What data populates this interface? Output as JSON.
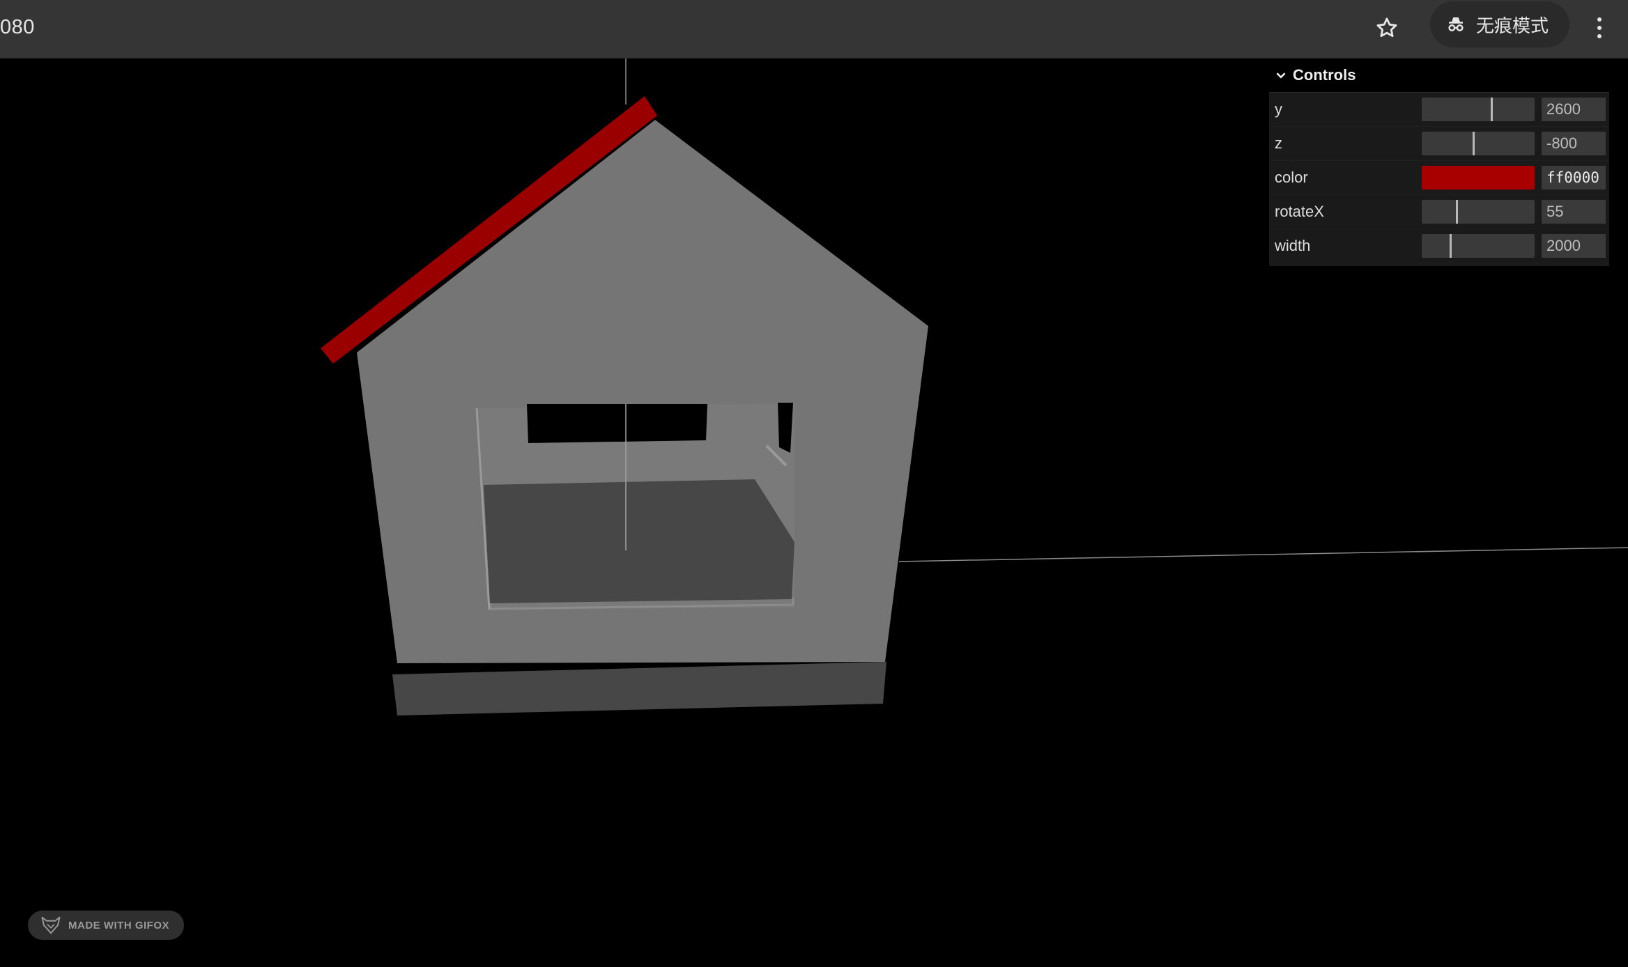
{
  "browser": {
    "url_fragment": "080",
    "incognito_label": "无痕模式",
    "icons": [
      "star-icon",
      "incognito-icon",
      "more-vert-icon"
    ]
  },
  "controls": {
    "title": "Controls",
    "rows": [
      {
        "name": "y",
        "value": "2600",
        "slider_fraction": 0.62
      },
      {
        "name": "z",
        "value": "-800",
        "slider_fraction": 0.46
      },
      {
        "name": "color",
        "value": "ff0000",
        "swatch": "#a80000"
      },
      {
        "name": "rotateX",
        "value": "55",
        "slider_fraction": 0.31
      },
      {
        "name": "width",
        "value": "2000",
        "slider_fraction": 0.25
      }
    ]
  },
  "scene": {
    "house_wall_color": "#757575",
    "house_floor_color": "#474747",
    "roof_color": "#9b0000",
    "background": "#000000"
  },
  "watermark": {
    "label": "MADE WITH GIFOX"
  }
}
